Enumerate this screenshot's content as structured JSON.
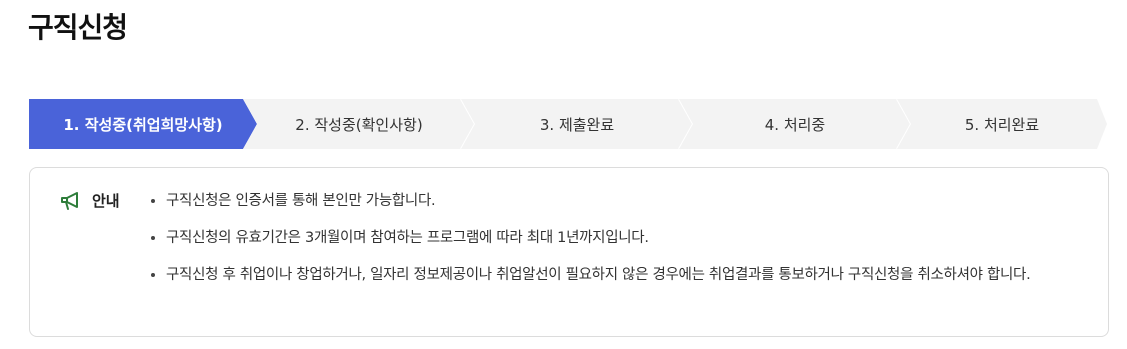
{
  "page": {
    "title": "구직신청"
  },
  "stepper": {
    "steps": [
      {
        "label": "1. 작성중(취업희망사항)",
        "active": true
      },
      {
        "label": "2. 작성중(확인사항)",
        "active": false
      },
      {
        "label": "3. 제출완료",
        "active": false
      },
      {
        "label": "4. 처리중",
        "active": false
      },
      {
        "label": "5. 처리완료",
        "active": false
      }
    ],
    "active_color": "#4a63d9",
    "inactive_color": "#f3f3f3"
  },
  "notice": {
    "icon": "megaphone-icon",
    "icon_color": "#2e7d3a",
    "title": "안내",
    "items": [
      "구직신청은 인증서를 통해 본인만 가능합니다.",
      "구직신청의 유효기간은 3개월이며 참여하는 프로그램에 따라 최대 1년까지입니다.",
      "구직신청 후 취업이나 창업하거나, 일자리 정보제공이나 취업알선이 필요하지 않은 경우에는 취업결과를 통보하거나 구직신청을 취소하셔야 합니다."
    ]
  }
}
